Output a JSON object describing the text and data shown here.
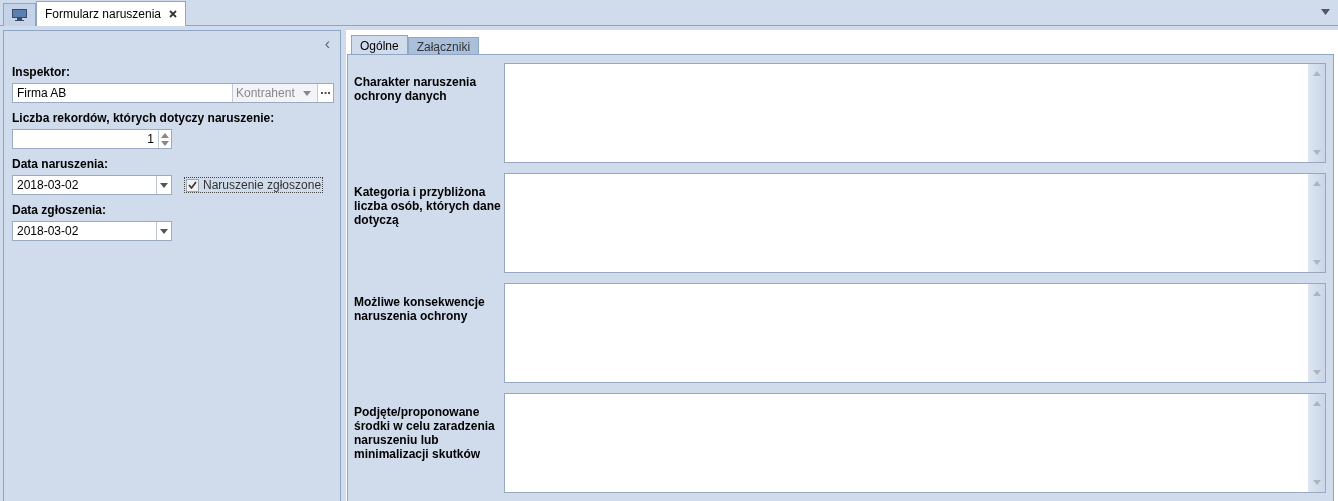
{
  "document_tabs": [
    {
      "kind": "icon",
      "selected": false
    },
    {
      "kind": "text",
      "label": "Formularz naruszenia",
      "closable": true,
      "selected": true
    }
  ],
  "left_panel": {
    "collapse": "‹",
    "fields": [
      {
        "kind": "lookup",
        "label": "Inspektor:",
        "value": "Firma AB",
        "type_value": "Kontrahent"
      },
      {
        "kind": "spin",
        "label": "Liczba rekordów, których dotyczy naruszenie:",
        "value": "1"
      },
      {
        "kind": "date",
        "label": "Data naruszenia:",
        "value": "2018-03-02",
        "checkbox": {
          "label": "Naruszenie zgłoszone",
          "checked": true
        }
      },
      {
        "kind": "date",
        "label": "Data zgłoszenia:",
        "value": "2018-03-02"
      }
    ]
  },
  "form_tabs": [
    {
      "label": "Ogólne",
      "selected": true
    },
    {
      "label": "Załączniki",
      "selected": false
    }
  ],
  "text_areas": [
    {
      "label": "Charakter naruszenia ochrony danych"
    },
    {
      "label": "Kategoria i przybliżona liczba osób, których dane dotyczą"
    },
    {
      "label": "Możliwe konsekwencje naruszenia ochrony"
    },
    {
      "label": "Podjęte/proponowane środki w celu zaradzenia naruszeniu lub minimalizacji skutków"
    }
  ]
}
